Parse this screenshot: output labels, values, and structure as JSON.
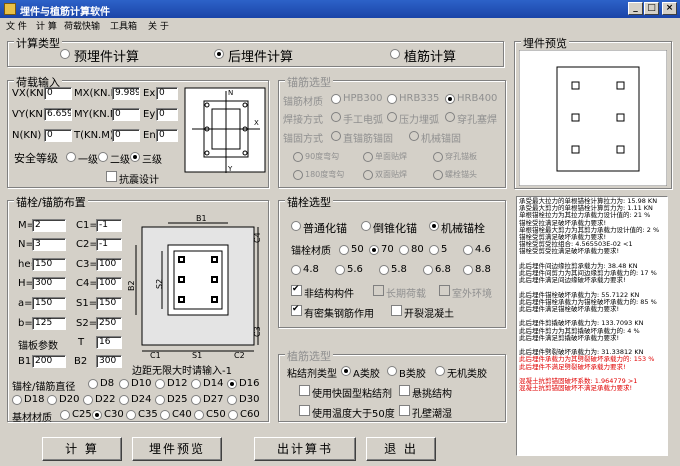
{
  "window": {
    "title": "埋件与植筋计算软件",
    "min": "_",
    "max": "□",
    "close": "×"
  },
  "menu": [
    "文 件",
    "计 算",
    "荷载快输",
    "工具箱",
    "关 于"
  ],
  "calc_type": {
    "caption": "计算类型",
    "options": [
      "预埋件计算",
      "后埋件计算",
      "植筋计算"
    ],
    "selected": 1
  },
  "load": {
    "caption": "荷载输入",
    "VX_label": "VX(KN)",
    "VX": "0",
    "MX_label": "MX(KN.M)",
    "MX": "9.989",
    "Ex_label": "Ex",
    "Ex": "0",
    "VY_label": "VY(KN)",
    "VY": "6.659",
    "MY_label": "MY(KN.M)",
    "MY": "0",
    "Ey_label": "Ey",
    "Ey": "0",
    "N_label": "N(KN)",
    "N": "0",
    "T_label": "T(KN.M)",
    "T": "0",
    "En_label": "En",
    "En": "0",
    "safety_label": "安全等级",
    "safety_options": [
      "一级",
      "二级",
      "三级"
    ],
    "safety_selected": 2,
    "seismic": "抗震设计"
  },
  "anchor_type": {
    "caption": "锚筋选型",
    "material_label": "锚筋材质",
    "materials": [
      "HPB300",
      "HRB335",
      "HRB400"
    ],
    "material_selected": 2,
    "weld_label": "焊接方式",
    "welds": [
      "手工电弧",
      "压力埋弧",
      "穿孔塞焊"
    ],
    "anchor_label": "锚固方式",
    "anchors": [
      "直锚筋锚固",
      "机械锚固"
    ],
    "hooks": [
      "90度弯勾",
      "单面贴焊",
      "穿孔锚板",
      "180度弯勾",
      "双面贴焊",
      "螺栓锚头"
    ]
  },
  "bolt_layout": {
    "caption": "锚栓/锚筋布置",
    "M_label": "M=",
    "M": "2",
    "C1_label": "C1=",
    "C1": "-1",
    "N_label": "N=",
    "N": "3",
    "C2_label": "C2=",
    "C2": "-1",
    "he_label": "he=",
    "he": "150",
    "C3_label": "C3=",
    "C3": "100",
    "H_label": "H=",
    "H": "300",
    "C4_label": "C4=",
    "C4": "100",
    "a_label": "a=",
    "a": "150",
    "S1_label": "S1=",
    "S1": "150",
    "b_label": "b=",
    "b": "125",
    "S2_label": "S2=",
    "S2": "250",
    "plate_label": "锚板参数",
    "T_label": "T",
    "T": "16",
    "B1_label": "B1",
    "B1": "200",
    "B2_label": "B2",
    "B2": "300",
    "edge_note": "边距无限大时请输入-1",
    "dia_label": "锚栓/锚筋直径",
    "diameters": [
      "D8",
      "D10",
      "D12",
      "D14",
      "D16",
      "D18",
      "D20",
      "D22",
      "D24",
      "D25",
      "D27",
      "D30"
    ],
    "dia_selected": 4,
    "concrete_label": "基材材质",
    "concretes": [
      "C25",
      "C30",
      "C35",
      "C40",
      "C50",
      "C60"
    ],
    "concrete_selected": 1
  },
  "diagram": {
    "B1": "B1",
    "B2": "B2",
    "S1": "S1",
    "S2": "S2",
    "C1": "C1",
    "C2": "C2",
    "C3": "C3",
    "C4": "C4"
  },
  "bolt_select": {
    "caption": "锚栓选型",
    "types": [
      "普通化锚",
      "倒锥化锚",
      "机械锚栓"
    ],
    "type_selected": 2,
    "material_label": "锚栓材质",
    "grades": [
      "5",
      "4.6",
      "4.8",
      "5.6",
      "5.8",
      "6.8",
      "8.8"
    ],
    "pre_prefix": "50",
    "pre_on": "70",
    "pre_mid": "80",
    "grade_selected": 1,
    "opts": [
      "非结构构件",
      "长期荷载",
      "室外环境",
      "有密集钢筋作用",
      "开裂混凝土"
    ]
  },
  "rebar_select": {
    "caption": "植筋选型",
    "glue_label": "粘结剂类型",
    "glues": [
      "A类胶",
      "B类胶",
      "无机类胶"
    ],
    "glue_selected": 0,
    "opts": [
      "使用快固型粘结剂",
      "悬挑结构",
      "使用温度大于50度",
      "孔壁潮湿"
    ]
  },
  "preview": {
    "caption": "埋件预览"
  },
  "results": [
    {
      "t": "承受最大拉力的单根锚栓计算拉力为: 15.98 KN",
      "c": ""
    },
    {
      "t": "承受最大剪力的单根锚栓计算剪力为: 1.11 KN",
      "c": ""
    },
    {
      "t": "单根锚栓拉力为其拉力承载力设计值的: 21 %",
      "c": ""
    },
    {
      "t": "锚栓受拉满足破坏承载力要求!",
      "c": ""
    },
    {
      "t": "单根锚栓最大剪力为其剪力承载力设计值的: 2 %",
      "c": ""
    },
    {
      "t": "锚栓受剪满足破坏承载力要求!",
      "c": ""
    },
    {
      "t": "锚栓受剪受拉组合: 4.565503E-02 <1",
      "c": ""
    },
    {
      "t": "锚栓受剪受拉满足破坏承载力要求!",
      "c": ""
    },
    {
      "t": "",
      "c": ""
    },
    {
      "t": "此后埋件间边缘拉剪承载力为: 38.48 KN",
      "c": ""
    },
    {
      "t": "此后埋件间剪力为其间边缘剪力承载力的: 17 %",
      "c": ""
    },
    {
      "t": "此后埋件满足间边缘破坏承载力要求!",
      "c": ""
    },
    {
      "t": "",
      "c": ""
    },
    {
      "t": "此后埋件锚栓破坏承载力为: 55.7122 KN",
      "c": ""
    },
    {
      "t": "此后埋件锚栓承载力为锚栓破坏承载力的: 85 %",
      "c": ""
    },
    {
      "t": "此后埋件满足锚栓破坏承载力要求!",
      "c": ""
    },
    {
      "t": "",
      "c": ""
    },
    {
      "t": "此后埋件剪撬破坏承载力为: 133.7093 KN",
      "c": ""
    },
    {
      "t": "此后埋件剪力为其剪撬破坏承载力的: 4 %",
      "c": ""
    },
    {
      "t": "此后埋件满足剪撬破坏承载力要求!",
      "c": ""
    },
    {
      "t": "",
      "c": ""
    },
    {
      "t": "此后埋件劈裂破坏承载力为: 31.33812 KN",
      "c": ""
    },
    {
      "t": "此后埋件承载力为其劈裂破坏承载力的: 153 %",
      "c": "red"
    },
    {
      "t": "此后埋件不满足劈裂破坏承载力要求!",
      "c": "red"
    },
    {
      "t": "",
      "c": ""
    },
    {
      "t": "混凝土抗剪锚固破坏系数: 1.964779 >1",
      "c": "red"
    },
    {
      "t": "混凝土抗剪锚固破坏不满足承载力要求!",
      "c": "red"
    }
  ],
  "buttons": {
    "calc": "计 算",
    "preview": "埋件预览",
    "book": "出计算书",
    "exit": "退 出"
  }
}
